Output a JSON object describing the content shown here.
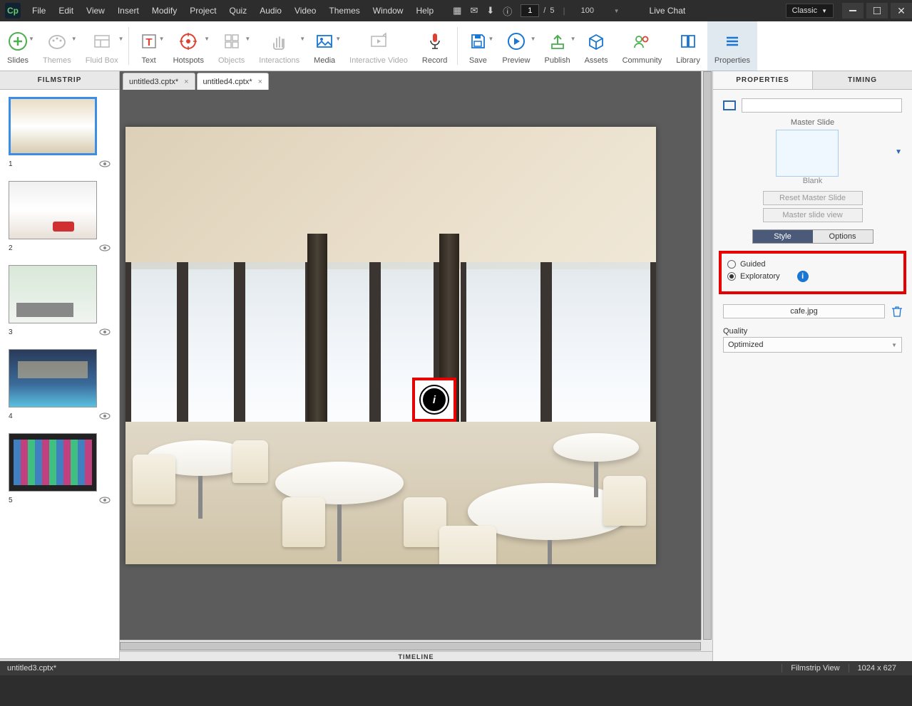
{
  "menubar": {
    "items": [
      "File",
      "Edit",
      "View",
      "Insert",
      "Modify",
      "Project",
      "Quiz",
      "Audio",
      "Video",
      "Themes",
      "Window",
      "Help"
    ],
    "page_current": "1",
    "page_sep": "/",
    "page_total": "5",
    "zoom": "100",
    "live_chat": "Live Chat",
    "workspace": "Classic"
  },
  "toolbar": {
    "items": [
      {
        "label": "Slides",
        "icon": "plus",
        "color": "#4caf50",
        "dd": true
      },
      {
        "label": "Themes",
        "icon": "palette",
        "color": "#b8b8b8",
        "dd": true,
        "disabled": true
      },
      {
        "label": "Fluid Box",
        "icon": "layout",
        "color": "#b8b8b8",
        "dd": true,
        "disabled": true
      },
      {
        "sep": true
      },
      {
        "label": "Text",
        "icon": "text",
        "color": "#e04030",
        "dd": true
      },
      {
        "label": "Hotspots",
        "icon": "target",
        "color": "#e04030",
        "dd": true
      },
      {
        "label": "Objects",
        "icon": "grid",
        "color": "#b8b8b8",
        "dd": true,
        "disabled": true
      },
      {
        "label": "Interactions",
        "icon": "hand",
        "color": "#b8b8b8",
        "dd": true,
        "disabled": true
      },
      {
        "label": "Media",
        "icon": "image",
        "color": "#1976d2",
        "dd": true
      },
      {
        "label": "Interactive Video",
        "icon": "ivideo",
        "color": "#b8b8b8",
        "disabled": true
      },
      {
        "label": "Record",
        "icon": "mic",
        "color": "#e04030"
      },
      {
        "sep": true
      },
      {
        "label": "Save",
        "icon": "save",
        "color": "#1976d2",
        "dd": true
      },
      {
        "label": "Preview",
        "icon": "play",
        "color": "#1976d2",
        "dd": true
      },
      {
        "label": "Publish",
        "icon": "upload",
        "color": "#4caf50",
        "dd": true
      },
      {
        "label": "Assets",
        "icon": "box",
        "color": "#1976d2"
      },
      {
        "label": "Community",
        "icon": "people",
        "color": "#4caf50"
      },
      {
        "label": "Library",
        "icon": "book",
        "color": "#1976d2"
      },
      {
        "label": "Properties",
        "icon": "menu",
        "color": "#1976d2",
        "active": true
      }
    ]
  },
  "tabs": [
    {
      "name": "untitled3.cptx*",
      "active": false
    },
    {
      "name": "untitled4.cptx*",
      "active": true
    }
  ],
  "filmstrip": {
    "title": "FILMSTRIP",
    "thumbs": [
      {
        "n": "1",
        "sel": true,
        "cls": "m1"
      },
      {
        "n": "2",
        "cls": "m2"
      },
      {
        "n": "3",
        "cls": "m3"
      },
      {
        "n": "4",
        "cls": "m4"
      },
      {
        "n": "5",
        "cls": "m5"
      }
    ]
  },
  "timeline": {
    "label": "TIMELINE"
  },
  "right_panel": {
    "tabs": {
      "properties": "PROPERTIES",
      "timing": "TIMING"
    },
    "master_slide_label": "Master Slide",
    "blank": "Blank",
    "reset_btn": "Reset Master Slide",
    "master_view_btn": "Master slide view",
    "style_tabs": {
      "style": "Style",
      "options": "Options"
    },
    "mode_guided": "Guided",
    "mode_exploratory": "Exploratory",
    "filename": "cafe.jpg",
    "quality_label": "Quality",
    "quality_value": "Optimized"
  },
  "statusbar": {
    "file": "untitled3.cptx*",
    "view": "Filmstrip View",
    "dim": "1024 x 627"
  }
}
